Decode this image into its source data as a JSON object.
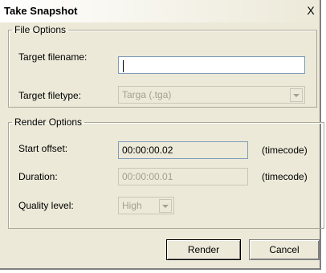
{
  "window": {
    "title": "Take Snapshot",
    "close_glyph": "X"
  },
  "file_options": {
    "legend": "File Options",
    "filename_label": "Target filename:",
    "filename_value": "",
    "filetype_label": "Target filetype:",
    "filetype_value": "Targa (.tga)"
  },
  "render_options": {
    "legend": "Render Options",
    "start_offset_label": "Start offset:",
    "start_offset_value": "00:00:00.02",
    "start_offset_suffix": "(timecode)",
    "duration_label": "Duration:",
    "duration_value": "00:00:00.01",
    "duration_suffix": "(timecode)",
    "quality_label": "Quality level:",
    "quality_value": "High"
  },
  "buttons": {
    "render": "Render",
    "cancel": "Cancel"
  },
  "icons": {
    "close": "close-icon",
    "dropdown": "chevron-down-icon"
  },
  "colors": {
    "dialog_bg": "#ece9d8",
    "field_border": "#7f9db9",
    "disabled_text": "#a3a091"
  }
}
